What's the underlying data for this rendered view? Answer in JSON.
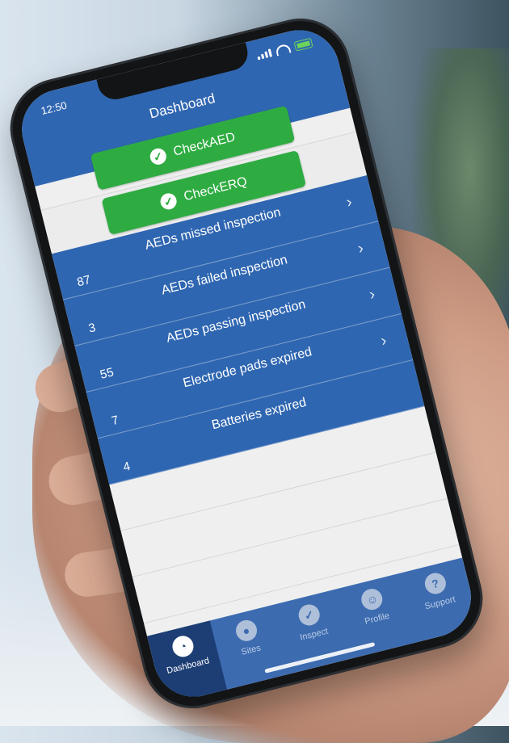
{
  "status": {
    "time": "12:50"
  },
  "header": {
    "title": "Dashboard"
  },
  "buttons": [
    {
      "label": "CheckAED"
    },
    {
      "label": "CheckERQ"
    }
  ],
  "stats": [
    {
      "label": "AEDs missed inspection",
      "count": "87"
    },
    {
      "label": "AEDs failed inspection",
      "count": "3"
    },
    {
      "label": "AEDs passing inspection",
      "count": "55"
    },
    {
      "label": "Electrode pads expired",
      "count": "7"
    },
    {
      "label": "Batteries expired",
      "count": "4"
    }
  ],
  "tabs": [
    {
      "label": "Dashboard",
      "icon": "gauge-icon"
    },
    {
      "label": "Sites",
      "icon": "map-pin-icon"
    },
    {
      "label": "Inspect",
      "icon": "check-circle-icon"
    },
    {
      "label": "Profile",
      "icon": "user-icon"
    },
    {
      "label": "Support",
      "icon": "question-icon"
    }
  ],
  "colors": {
    "primary": "#2f66b1",
    "active_tab": "#1d3e74",
    "accent_green": "#2eac41"
  }
}
